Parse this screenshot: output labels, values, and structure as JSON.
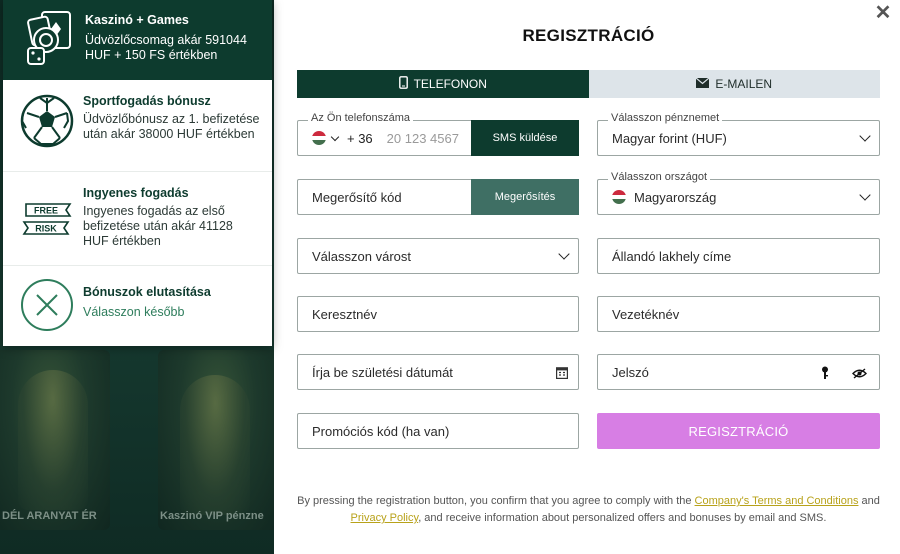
{
  "background": {
    "card_text_left": "DÉL ARANYAT ÉR",
    "card_text_right": "Kaszinó VIP pénzne"
  },
  "bonuses": {
    "casino": {
      "title": "Kaszinó + Games",
      "desc": "Üdvözlőcsomag akár 591044 HUF + 150 FS értékben",
      "icon": "cards-dice-icon"
    },
    "sport": {
      "title": "Sportfogadás bónusz",
      "desc": "Üdvözlőbónusz az 1. befizetése után akár 38000 HUF értékben",
      "icon": "soccer-ball-icon"
    },
    "freebet": {
      "title": "Ingyenes fogadás",
      "desc": "Ingyenes fogadás az első befizetése után akár 41128 HUF értékben",
      "icon_line1": "FREE",
      "icon_line2": "RISK"
    },
    "decline": {
      "title": "Bónuszok elutasítása",
      "link": "Válasszon később"
    }
  },
  "form": {
    "title": "REGISZTRÁCIÓ",
    "tabs": {
      "phone": "TELEFONON",
      "email": "E-MAILEN"
    },
    "phone": {
      "label": "Az Ön telefonszáma",
      "prefix": "+ 36",
      "placeholder": "20 123 4567",
      "sms_button": "SMS küldése"
    },
    "currency": {
      "label": "Válasszon pénznemet",
      "value": "Magyar forint (HUF)"
    },
    "code": {
      "placeholder": "Megerősítő kód",
      "button": "Megerősítés"
    },
    "country": {
      "label": "Válasszon országot",
      "value": "Magyarország"
    },
    "city": {
      "placeholder": "Válasszon várost"
    },
    "address": {
      "placeholder": "Állandó lakhely címe"
    },
    "firstname": {
      "placeholder": "Keresztnév"
    },
    "lastname": {
      "placeholder": "Vezetéknév"
    },
    "birthdate": {
      "placeholder": "Írja be születési dátumát"
    },
    "password": {
      "placeholder": "Jelszó"
    },
    "promo": {
      "placeholder": "Promóciós kód (ha van)"
    },
    "submit": "REGISZTRÁCIÓ"
  },
  "legal": {
    "part1": "By pressing the registration button, you confirm that you agree to comply with the ",
    "link1": "Company's Terms and Conditions",
    "part2": " and ",
    "link2": "Privacy Policy",
    "part3": ", and receive information about personalized offers and bonuses by email and SMS."
  },
  "colors": {
    "brand_dark": "#0d3b2e",
    "submit": "#d77ee4",
    "link": "#b8a21a",
    "tab_inactive": "#dde4e9"
  }
}
